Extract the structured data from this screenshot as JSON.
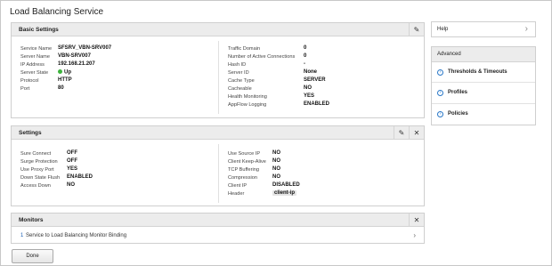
{
  "page": {
    "title": "Load Balancing Service"
  },
  "basic": {
    "title": "Basic Settings",
    "left": [
      {
        "label": "Service Name",
        "value": "SFSRV_VBN-SRV007"
      },
      {
        "label": "Server Name",
        "value": "VBN-SRV007"
      },
      {
        "label": "IP Address",
        "value": "192.168.21.207"
      },
      {
        "label": "Server State",
        "value": "Up"
      },
      {
        "label": "Protocol",
        "value": "HTTP"
      },
      {
        "label": "Port",
        "value": "80"
      }
    ],
    "right": [
      {
        "label": "Traffic Domain",
        "value": "0"
      },
      {
        "label": "Number of Active Connections",
        "value": "0"
      },
      {
        "label": "Hash ID",
        "value": "-"
      },
      {
        "label": "Server ID",
        "value": "None"
      },
      {
        "label": "Cache Type",
        "value": "SERVER"
      },
      {
        "label": "Cacheable",
        "value": "NO"
      },
      {
        "label": "Health Monitoring",
        "value": "YES"
      },
      {
        "label": "AppFlow Logging",
        "value": "ENABLED"
      }
    ],
    "state_color": "#3db43d"
  },
  "settings": {
    "title": "Settings",
    "left": [
      {
        "label": "Sure Connect",
        "value": "OFF"
      },
      {
        "label": "Surge Protection",
        "value": "OFF"
      },
      {
        "label": "Use Proxy Port",
        "value": "YES"
      },
      {
        "label": "Down State Flush",
        "value": "ENABLED"
      },
      {
        "label": "Access Down",
        "value": "NO"
      }
    ],
    "right": [
      {
        "label": "Use Source IP",
        "value": "NO"
      },
      {
        "label": "Client Keep-Alive",
        "value": "NO"
      },
      {
        "label": "TCP Buffering",
        "value": "NO"
      },
      {
        "label": "Compression",
        "value": "NO"
      },
      {
        "label": "Client IP",
        "value": "DISABLED"
      },
      {
        "label": "Header",
        "value": "client-ip"
      }
    ]
  },
  "monitors": {
    "title": "Monitors",
    "binding_count": "1",
    "binding_text": "Service to Load Balancing Monitor Binding"
  },
  "sidebar": {
    "help_label": "Help",
    "advanced_label": "Advanced",
    "items": [
      {
        "label": "Thresholds & Timeouts"
      },
      {
        "label": "Profiles"
      },
      {
        "label": "Policies"
      }
    ]
  },
  "footer": {
    "done_label": "Done"
  },
  "icons": {
    "edit": "pencil-icon",
    "close": "close-icon",
    "chevron": "chevron-right-icon",
    "add": "circle-chevron-icon"
  },
  "colors": {
    "link": "#1a5fb4",
    "accent": "#2a78c8",
    "state_up": "#3db43d"
  }
}
